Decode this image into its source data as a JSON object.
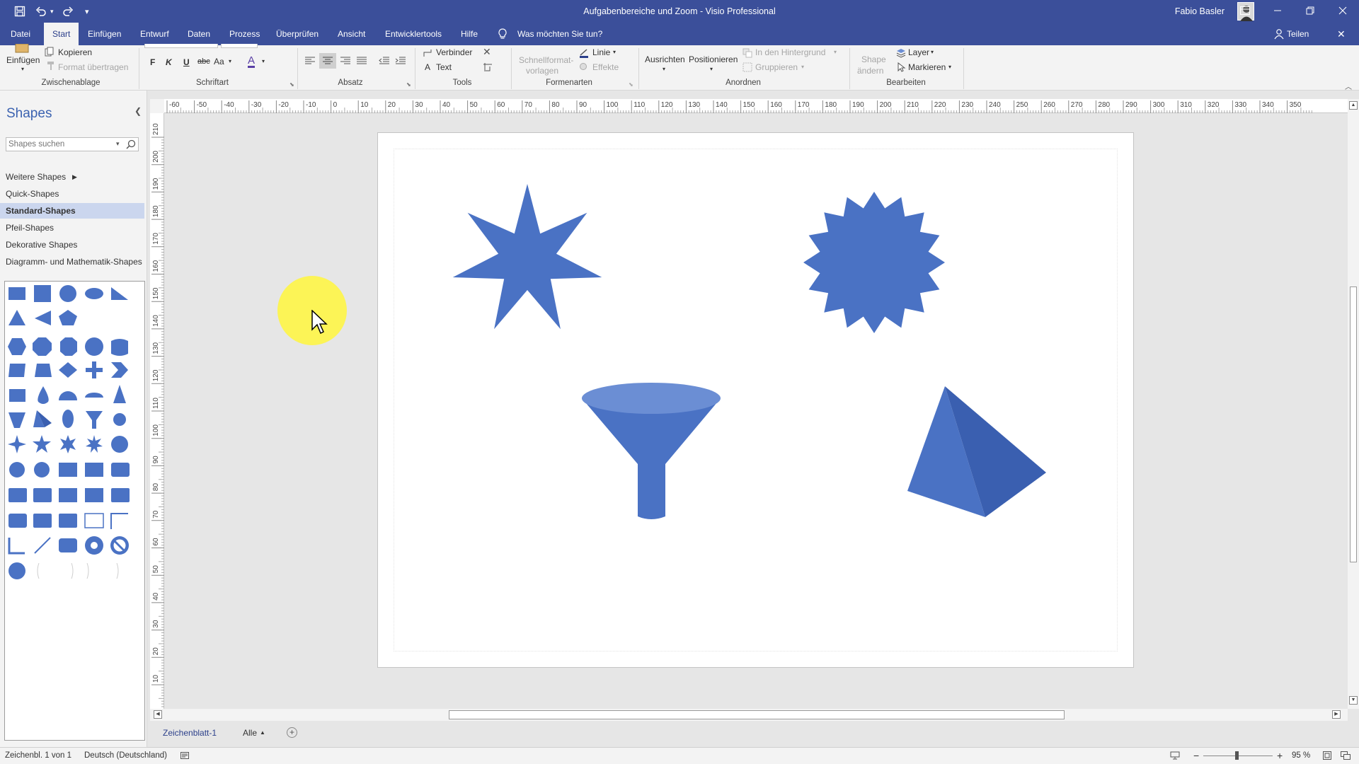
{
  "title_bar": {
    "title": "Aufgabenbereiche und Zoom  -  Visio Professional",
    "user_name": "Fabio Basler",
    "qat_icons": [
      "save-icon",
      "undo-icon",
      "redo-icon",
      "customize-qat-icon"
    ],
    "window_icons": [
      "ribbon-display-icon",
      "minimize-icon",
      "restore-icon",
      "close-icon"
    ]
  },
  "tabs": [
    {
      "label": "Datei"
    },
    {
      "label": "Start",
      "active": true
    },
    {
      "label": "Einfügen"
    },
    {
      "label": "Entwurf"
    },
    {
      "label": "Daten"
    },
    {
      "label": "Prozess"
    },
    {
      "label": "Überprüfen"
    },
    {
      "label": "Ansicht"
    },
    {
      "label": "Entwicklertools"
    },
    {
      "label": "Hilfe"
    }
  ],
  "tell_me": "Was möchten Sie tun?",
  "share": "Teilen",
  "ribbon": {
    "clipboard": {
      "paste": "Einfügen",
      "copy": "Kopieren",
      "format_painter": "Format übertragen",
      "label": "Zwischenablage"
    },
    "font": {
      "bold": "F",
      "italic": "K",
      "underline": "U",
      "strike": "abc",
      "case": "Aa",
      "color": "A",
      "label": "Schriftart"
    },
    "paragraph": {
      "label": "Absatz"
    },
    "tools": {
      "connector": "Verbinder",
      "text": "Text",
      "label": "Tools"
    },
    "shape_styles": {
      "quick_styles_1": "Schnellformat-",
      "quick_styles_2": "vorlagen",
      "line": "Linie",
      "effects": "Effekte",
      "label": "Formenarten"
    },
    "arrange": {
      "align": "Ausrichten",
      "position": "Positionieren",
      "send_back": "In den Hintergrund",
      "group": "Gruppieren",
      "label": "Anordnen"
    },
    "edit": {
      "change_shape_1": "Shape",
      "change_shape_2": "ändern",
      "layer": "Layer",
      "select": "Markieren",
      "label": "Bearbeiten"
    }
  },
  "shapes_panel": {
    "title": "Shapes",
    "search_placeholder": "Shapes suchen",
    "more_shapes": "Weitere Shapes",
    "items": [
      {
        "label": "Quick-Shapes"
      },
      {
        "label": "Standard-Shapes",
        "selected": true
      },
      {
        "label": "Pfeil-Shapes"
      },
      {
        "label": "Dekorative Shapes"
      },
      {
        "label": "Diagramm- und Mathematik-Shapes"
      }
    ],
    "stencil_color": "#4a72c4"
  },
  "rulers": {
    "horizontal": [
      "-60",
      "-50",
      "-40",
      "-30",
      "-20",
      "-10",
      "0",
      "10",
      "20",
      "30",
      "40",
      "50",
      "60",
      "70",
      "80",
      "90",
      "100",
      "110",
      "120",
      "130",
      "140",
      "150",
      "160",
      "170",
      "180",
      "190",
      "200",
      "210",
      "220",
      "230",
      "240",
      "250",
      "260",
      "270",
      "280",
      "290",
      "300",
      "310",
      "320",
      "330",
      "340",
      "350"
    ],
    "vertical": [
      "210",
      "200",
      "190",
      "180",
      "170",
      "160",
      "150",
      "140",
      "130",
      "120",
      "110",
      "100",
      "90",
      "80",
      "70",
      "60",
      "50",
      "40",
      "30",
      "20",
      "10"
    ]
  },
  "drawing": {
    "shape_color": "#4a72c4",
    "shape_dark": "#3a5fb0",
    "shape_light": "#6b8ed4",
    "shapes": [
      "7-point-star",
      "24-point-star",
      "funnel",
      "pyramid"
    ]
  },
  "sheet_tabs": {
    "active": "Zeichenblatt-1",
    "all": "Alle"
  },
  "status_bar": {
    "page": "Zeichenbl. 1 von 1",
    "language": "Deutsch (Deutschland)",
    "zoom": "95 %"
  }
}
